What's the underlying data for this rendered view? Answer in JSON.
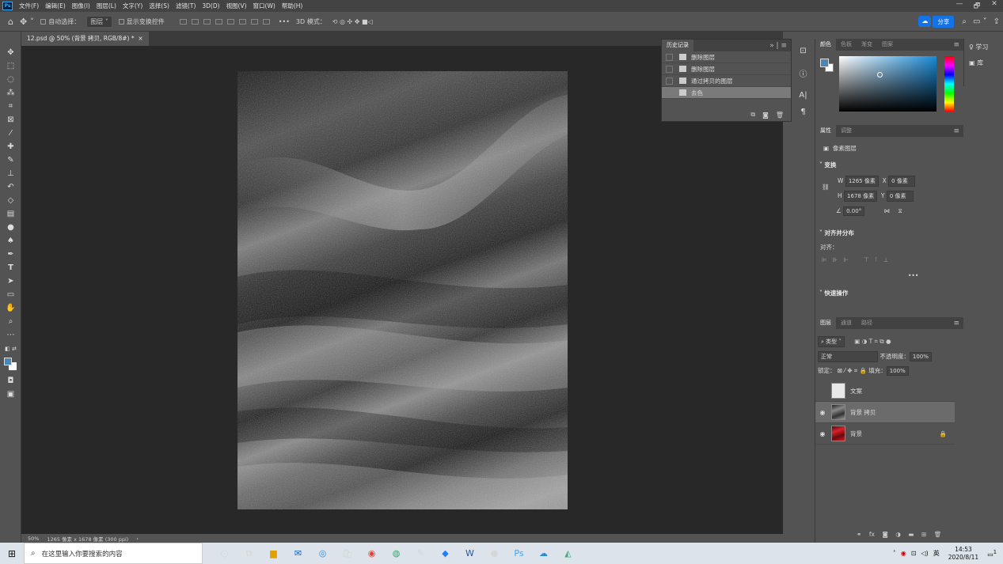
{
  "app": {
    "logo": "Ps"
  },
  "menubar": {
    "items": [
      "文件(F)",
      "编辑(E)",
      "图像(I)",
      "图层(L)",
      "文字(Y)",
      "选择(S)",
      "滤镜(T)",
      "3D(D)",
      "视图(V)",
      "窗口(W)",
      "帮助(H)"
    ],
    "window_controls": [
      "—",
      "🗗",
      "✕"
    ]
  },
  "options": {
    "auto_select_label": "自动选择：",
    "auto_select_value": "图层",
    "show_transform_label": "显示变换控件",
    "more": "•••",
    "mode_3d_label": "3D 模式：",
    "share_label": "分享"
  },
  "document": {
    "tab_title": "12.psd @ 50% (背景 拷贝, RGB/8#) *",
    "tab_close": "×"
  },
  "status": {
    "zoom": "50%",
    "doc_info": "1265 像素 x 1678 像素 (300 ppi)",
    "arrow": "›"
  },
  "history_panel": {
    "title": "历史记录",
    "items": [
      {
        "label": "删除图层",
        "selected": false
      },
      {
        "label": "删除图层",
        "selected": false
      },
      {
        "label": "通过拷贝的图层",
        "selected": false
      },
      {
        "label": "去色",
        "selected": true
      }
    ]
  },
  "learn_panel": {
    "learn_label": "学习",
    "library_label": "库"
  },
  "color_panel": {
    "tabs": [
      "颜色",
      "色板",
      "渐变",
      "图案"
    ],
    "foreground": "#4d86b5",
    "background": "#ffffff"
  },
  "properties_panel": {
    "tabs": [
      "属性",
      "调整"
    ],
    "type_label": "像素图层",
    "transform_title": "变换",
    "w_label": "W",
    "w_value": "1265 像素",
    "h_label": "H",
    "h_value": "1678 像素",
    "x_label": "X",
    "x_value": "0 像素",
    "y_label": "Y",
    "y_value": "0 像素",
    "angle_value": "0.00°",
    "align_title": "对齐并分布",
    "align_label": "对齐：",
    "more": "•••",
    "quick_title": "快速操作"
  },
  "layers_panel": {
    "tabs": [
      "图层",
      "通道",
      "路径"
    ],
    "filter_label": "类型",
    "blend_mode": "正常",
    "opacity_label": "不透明度：",
    "opacity_value": "100%",
    "lock_label": "锁定：",
    "fill_label": "填充：",
    "fill_value": "100%",
    "layers": [
      {
        "name": "文案",
        "visible": false,
        "selected": false,
        "locked": false,
        "thumb_color": "#e8e8e8"
      },
      {
        "name": "背景 拷贝",
        "visible": true,
        "selected": true,
        "locked": false,
        "thumb_color": "#5a5a5a"
      },
      {
        "name": "背景",
        "visible": true,
        "selected": false,
        "locked": true,
        "thumb_color": "#b3151b"
      }
    ]
  },
  "taskbar": {
    "search_placeholder": "在这里输入你要搜索的内容",
    "ime_label": "英",
    "time": "14:53",
    "date": "2020/8/11",
    "notification_count": "1"
  }
}
